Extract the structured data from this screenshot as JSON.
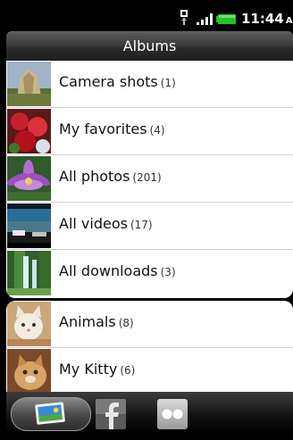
{
  "status_bar": {
    "time": "11:44",
    "ampm": "AM",
    "icons": [
      "usb-debug-icon",
      "signal-icon",
      "battery-icon"
    ]
  },
  "header": {
    "title": "Albums"
  },
  "albums": [
    {
      "name": "Camera shots",
      "count": "(1)"
    },
    {
      "name": "My favorites",
      "count": "(4)"
    },
    {
      "name": "All photos",
      "count": "(201)"
    },
    {
      "name": "All videos",
      "count": "(17)"
    },
    {
      "name": "All downloads",
      "count": "(3)"
    },
    {
      "name": "Animals",
      "count": "(8)"
    },
    {
      "name": "My Kitty",
      "count": "(6)"
    }
  ],
  "tabs": [
    {
      "icon": "gallery-icon",
      "selected": true
    },
    {
      "icon": "facebook-icon",
      "selected": false
    },
    {
      "icon": "flickr-icon",
      "selected": false
    }
  ],
  "colors": {
    "header_bg": "#2a2a2a",
    "list_bg": "#ffffff",
    "divider": "#cfcfcf",
    "battery": "#22c322"
  }
}
